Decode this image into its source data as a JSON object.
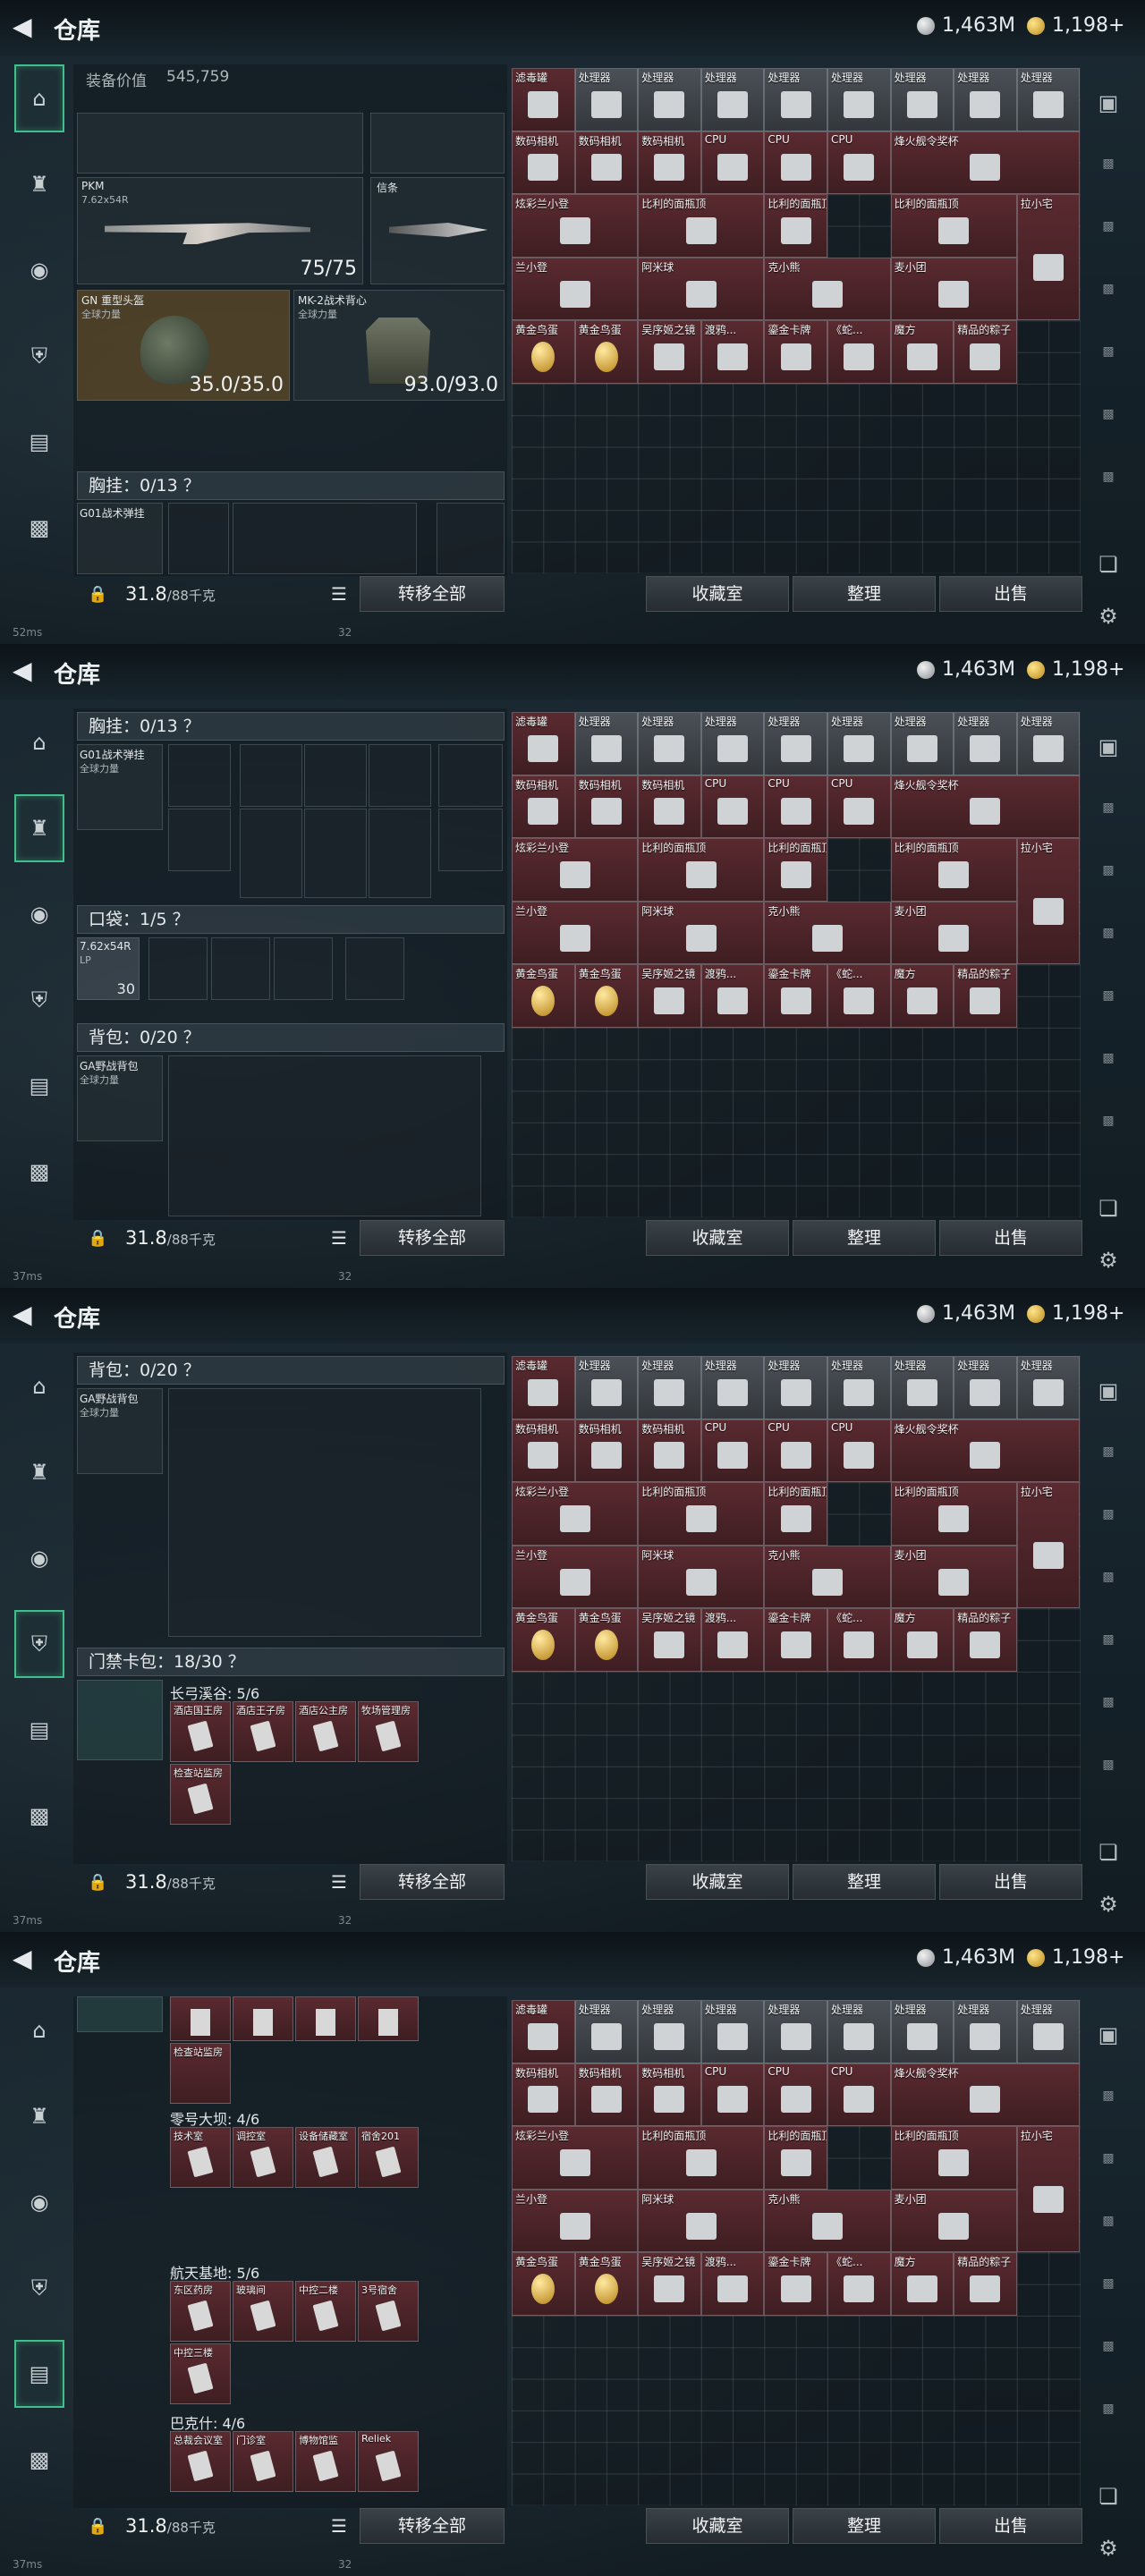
{
  "header": {
    "title": "仓库",
    "silver_amount": "1,463M",
    "gold_amount": "1,198+"
  },
  "left_nav": {
    "icons": [
      "pistol-icon",
      "armor-vest-icon",
      "helmet-icon",
      "backpack-icon",
      "chest-rig-icon",
      "briefcase-icon"
    ]
  },
  "screens": [
    {
      "active_nav": 0,
      "ping": "52ms",
      "page_num": "32"
    },
    {
      "active_nav": 1,
      "ping": "37ms",
      "page_num": "32"
    },
    {
      "active_nav": 3,
      "ping": "37ms",
      "page_num": "32"
    },
    {
      "active_nav": 4,
      "ping": "37ms",
      "page_num": "32"
    }
  ],
  "equipment": {
    "value_label": "装备价值",
    "value": "545,759",
    "primary_weapon": {
      "name": "PKM",
      "ammo_type": "7.62x54R",
      "ammo": "75/75"
    },
    "melee": {
      "name": "信条"
    },
    "helmet": {
      "name": "GN 重型头盔",
      "subtitle": "全球力量",
      "durability": "35.0/35.0"
    },
    "armor": {
      "name": "MK-2战术背心",
      "subtitle": "全球力量",
      "durability": "93.0/93.0"
    }
  },
  "chest_rig": {
    "label": "胸挂：0/13 ？",
    "item_name": "G01战术弹挂",
    "item_sub": "全球力量"
  },
  "pockets": {
    "label": "口袋：1/5 ？",
    "ammo_name": "7.62x54R",
    "ammo_sub": "LP",
    "ammo_count": "30"
  },
  "backpack": {
    "label": "背包：0/20 ？",
    "item_name": "GA野战背包",
    "item_sub": "全球力量"
  },
  "keycard": {
    "label": "门禁卡包：18/30 ？",
    "groups": [
      {
        "title": "长弓溪谷: 5/6",
        "cards": [
          "酒店国王房",
          "酒店王子房",
          "酒店公主房",
          "牧场管理房",
          "检查站监房"
        ]
      },
      {
        "title": "零号大坝: 4/6",
        "cards": [
          "技术室",
          "调控室",
          "设备储藏室",
          "宿舍201"
        ]
      },
      {
        "title": "航天基地: 5/6",
        "cards": [
          "东区药房",
          "玻璃间",
          "中控二楼",
          "3号宿舍",
          "中控三楼"
        ]
      },
      {
        "title": "巴克什: 4/6",
        "cards": [
          "总裁会议室",
          "门诊室",
          "博物馆监",
          "Reliek"
        ]
      }
    ]
  },
  "bottom": {
    "weight_value": "31.8",
    "weight_max": "/88千克",
    "transfer_all": "转移全部",
    "collection": "收藏室",
    "sort": "整理",
    "sell": "出售"
  },
  "stash_items": [
    {
      "name": "滤毒罐",
      "color": "red"
    },
    {
      "name": "处理器",
      "color": "gray"
    },
    {
      "name": "处理器",
      "color": "gray"
    },
    {
      "name": "处理器",
      "color": "gray"
    },
    {
      "name": "处理器",
      "color": "gray"
    },
    {
      "name": "处理器",
      "color": "gray"
    },
    {
      "name": "处理器",
      "color": "gray"
    },
    {
      "name": "处理器",
      "color": "gray"
    },
    {
      "name": "处理器",
      "color": "gray"
    },
    {
      "name": "数码相机",
      "color": "red"
    },
    {
      "name": "数码相机",
      "color": "red"
    },
    {
      "name": "数码相机",
      "color": "red"
    },
    {
      "name": "CPU",
      "color": "red"
    },
    {
      "name": "CPU",
      "color": "red"
    },
    {
      "name": "CPU",
      "color": "red"
    },
    {
      "name": "烽火舰令奖杯",
      "color": "red"
    },
    {
      "name": "炫彩兰小登",
      "color": "red"
    },
    {
      "name": "比利的面瓶顶",
      "color": "red"
    },
    {
      "name": "比利的面瓶顶",
      "color": "red"
    },
    {
      "name": "比利的面瓶顶",
      "color": "red"
    },
    {
      "name": "拉小宅",
      "color": "red"
    },
    {
      "name": "兰小登",
      "color": "red"
    },
    {
      "name": "阿米球",
      "color": "red"
    },
    {
      "name": "克小熊",
      "color": "red"
    },
    {
      "name": "麦小团",
      "color": "red"
    },
    {
      "name": "黄金鸟蛋",
      "color": "red"
    },
    {
      "name": "黄金鸟蛋",
      "color": "red"
    },
    {
      "name": "吴序姬之镜",
      "color": "red"
    },
    {
      "name": "渡鸦...",
      "color": "red"
    },
    {
      "name": "鎏金卡牌",
      "color": "red"
    },
    {
      "name": "《蛇...",
      "color": "red"
    },
    {
      "name": "魔方",
      "color": "red"
    },
    {
      "name": "精品的粽子",
      "color": "red"
    }
  ]
}
